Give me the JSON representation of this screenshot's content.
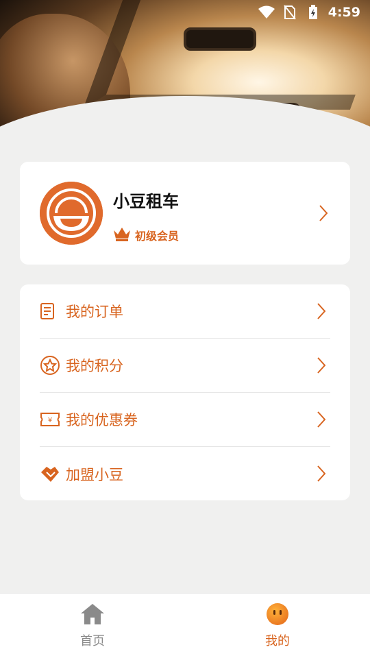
{
  "status_bar": {
    "time": "4:59",
    "icons": [
      "wifi-icon",
      "no-sim-icon",
      "battery-charging-icon"
    ]
  },
  "profile": {
    "name": "小豆租车",
    "member_level": "初级会员",
    "avatar_icon": "brand-logo-icon",
    "crown_icon": "crown-icon"
  },
  "menu": {
    "items": [
      {
        "label": "我的订单",
        "icon": "order-list-icon"
      },
      {
        "label": "我的积分",
        "icon": "star-circle-icon"
      },
      {
        "label": "我的优惠券",
        "icon": "coupon-icon"
      },
      {
        "label": "加盟小豆",
        "icon": "handshake-icon"
      }
    ]
  },
  "bottom_nav": {
    "items": [
      {
        "label": "首页",
        "icon": "home-icon",
        "active": false
      },
      {
        "label": "我的",
        "icon": "face-icon",
        "active": true
      }
    ]
  },
  "colors": {
    "accent": "#d8641f",
    "inactive": "#8a8a8a",
    "background": "#f0f0ef"
  }
}
